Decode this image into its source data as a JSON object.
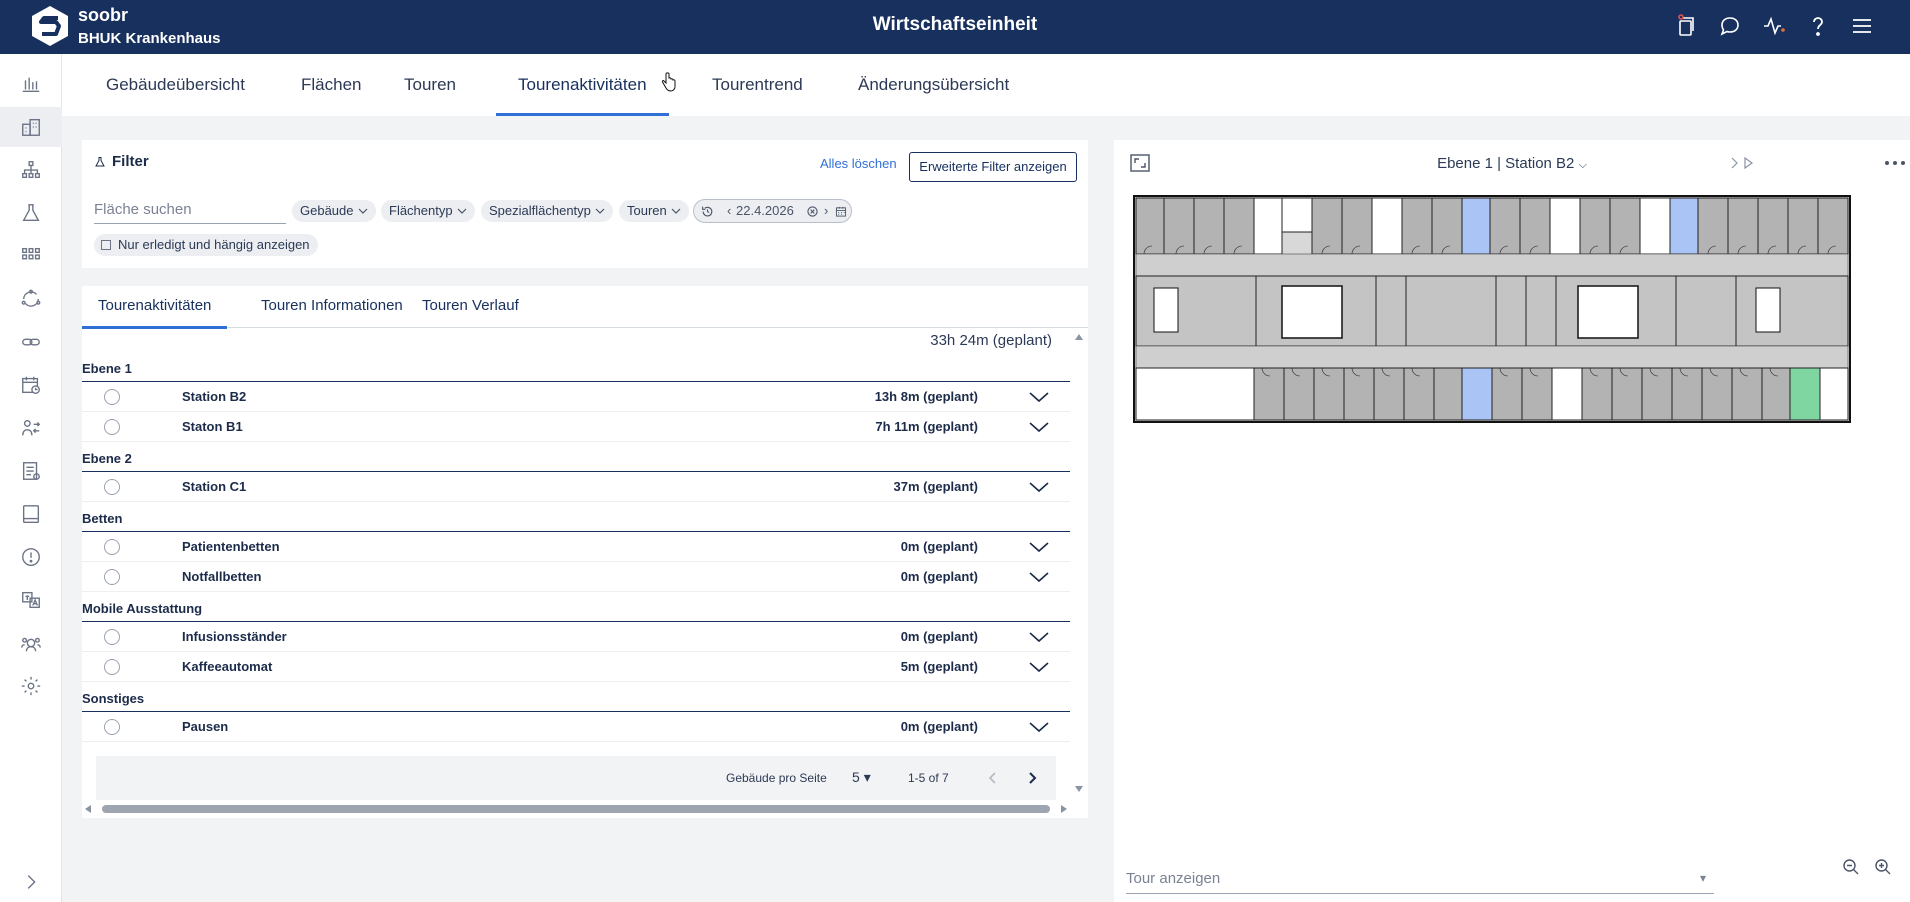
{
  "header": {
    "brand": "soobr",
    "site": "BHUK Krankenhaus",
    "title": "Wirtschaftseinheit",
    "icons": [
      "devices-icon",
      "chat-icon",
      "activity-icon",
      "help-icon",
      "menu-icon"
    ]
  },
  "sidebar": {
    "items": [
      "analytics-icon",
      "buildings-icon",
      "hierarchy-icon",
      "flask-icon",
      "grid-icon",
      "refresh-cycle-icon",
      "link-icon",
      "calendar-clock-icon",
      "user-swap-icon",
      "report-icon",
      "tablet-icon",
      "alert-icon",
      "translate-icon",
      "team-settings-icon",
      "settings-icon"
    ],
    "expand_icon": "chevron-right-icon"
  },
  "topnav": {
    "tabs": [
      "Gebäudeübersicht",
      "Flächen",
      "Touren",
      "Tourenaktivitäten",
      "Tourentrend",
      "Änderungsübersicht"
    ],
    "active": "Tourenaktivitäten"
  },
  "filter": {
    "title": "Filter",
    "clear_label": "Alles löschen",
    "advanced_label": "Erweiterte Filter anzeigen",
    "search_placeholder": "Fläche suchen",
    "chips": [
      "Gebäude",
      "Flächentyp",
      "Spezialflächentyp",
      "Touren"
    ],
    "date": "22.4.2026",
    "only_done_label": "Nur erledigt und hängig anzeigen"
  },
  "subtabs": {
    "tabs": [
      "Tourenaktivitäten",
      "Touren Informationen",
      "Touren Verlauf"
    ],
    "active": "Tourenaktivitäten"
  },
  "list": {
    "total": "33h 24m (geplant)",
    "groups": [
      {
        "title": "Ebene 1",
        "rows": [
          {
            "name": "Station B2",
            "duration": "13h 8m (geplant)"
          },
          {
            "name": "Staton B1",
            "duration": "7h 11m (geplant)"
          }
        ]
      },
      {
        "title": "Ebene 2",
        "rows": [
          {
            "name": "Station C1",
            "duration": "37m (geplant)"
          }
        ]
      },
      {
        "title": "Betten",
        "rows": [
          {
            "name": "Patientenbetten",
            "duration": "0m (geplant)"
          },
          {
            "name": "Notfallbetten",
            "duration": "0m (geplant)"
          }
        ]
      },
      {
        "title": "Mobile Ausstattung",
        "rows": [
          {
            "name": "Infusionsständer",
            "duration": "0m (geplant)"
          },
          {
            "name": "Kaffeeautomat",
            "duration": "5m (geplant)"
          }
        ]
      },
      {
        "title": "Sonstiges",
        "rows": [
          {
            "name": "Pausen",
            "duration": "0m (geplant)"
          }
        ]
      }
    ]
  },
  "pager": {
    "label": "Gebäude pro Seite",
    "per_page": "5",
    "range": "1-5 of 7"
  },
  "map": {
    "title": "Ebene 1 | Station B2",
    "select_placeholder": "Tour anzeigen",
    "highlight_colors": {
      "blue": "#a9c4f5",
      "green": "#7fd6a0"
    }
  },
  "colors": {
    "header": "#17305e",
    "accent": "#2f6fd6"
  }
}
